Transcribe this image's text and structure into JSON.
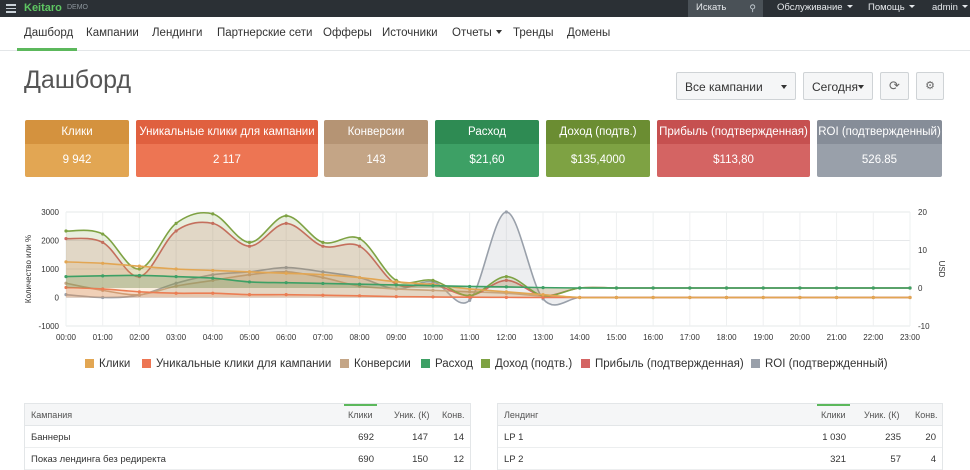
{
  "topbar": {
    "logo": "Keitaro",
    "demo": "DEMO",
    "search_label": "Искать",
    "service": "Обслуживание",
    "help": "Помощь",
    "user": "admin"
  },
  "nav": {
    "items": [
      "Дашборд",
      "Кампании",
      "Лендинги",
      "Партнерские сети",
      "Офферы",
      "Источники",
      "Отчеты",
      "Тренды",
      "Домены"
    ]
  },
  "title": "Дашборд",
  "controls": {
    "campaign_select": "Все кампании",
    "period_select": "Сегодня"
  },
  "stats": [
    {
      "label": "Клики",
      "value": "9 942",
      "head_color": "#d4923e",
      "body_color": "#e2a653"
    },
    {
      "label": "Уникальные клики для кампании",
      "value": "2 117",
      "head_color": "#e0603f",
      "body_color": "#ed7553"
    },
    {
      "label": "Конверсии",
      "value": "143",
      "head_color": "#b59474",
      "body_color": "#c4a586"
    },
    {
      "label": "Расход",
      "value": "$21,60",
      "head_color": "#2e8b53",
      "body_color": "#3da065"
    },
    {
      "label": "Доход (подтв.)",
      "value": "$135,4000",
      "head_color": "#6b8d32",
      "body_color": "#7ea243"
    },
    {
      "label": "Прибыль (подтвержденная)",
      "value": "$113,80",
      "head_color": "#c65050",
      "body_color": "#d46463"
    },
    {
      "label": "ROI (подтвержденный)",
      "value": "526.85",
      "head_color": "#868d98",
      "body_color": "#99a0aa"
    }
  ],
  "chart_data": {
    "type": "line",
    "ylabel_left": "Количество или %",
    "ylabel_right": "USD",
    "ylim_left": [
      -1000,
      3000
    ],
    "ylim_right": [
      -10,
      20
    ],
    "y_ticks_left": [
      "3000",
      "2000",
      "1000",
      "0",
      "-1000"
    ],
    "y_ticks_right": [
      "20",
      "10",
      "0",
      "-10"
    ],
    "categories": [
      "00:00",
      "01:00",
      "02:00",
      "03:00",
      "04:00",
      "05:00",
      "06:00",
      "07:00",
      "08:00",
      "09:00",
      "10:00",
      "11:00",
      "12:00",
      "13:00",
      "14:00",
      "15:00",
      "16:00",
      "17:00",
      "18:00",
      "19:00",
      "20:00",
      "21:00",
      "22:00",
      "23:00"
    ],
    "series": [
      {
        "name": "Клики",
        "color": "#e2a653",
        "axis": "left",
        "values": [
          1250,
          1200,
          1100,
          1000,
          950,
          900,
          850,
          800,
          700,
          550,
          450,
          300,
          200,
          100,
          0,
          0,
          0,
          0,
          0,
          0,
          0,
          0,
          0,
          0
        ]
      },
      {
        "name": "Уникальные клики для кампании",
        "color": "#ed7553",
        "axis": "left",
        "values": [
          350,
          300,
          200,
          150,
          150,
          100,
          100,
          80,
          60,
          30,
          20,
          10,
          5,
          0,
          0,
          0,
          0,
          0,
          0,
          0,
          0,
          0,
          0,
          0
        ]
      },
      {
        "name": "Конверсии",
        "color": "#c4a586",
        "axis": "left",
        "values": [
          500,
          250,
          100,
          400,
          600,
          800,
          900,
          700,
          400,
          300,
          250,
          200,
          150,
          50,
          0,
          0,
          0,
          0,
          0,
          0,
          0,
          0,
          0,
          0
        ]
      },
      {
        "name": "Расход",
        "color": "#3da065",
        "axis": "right",
        "values": [
          3,
          3.2,
          3.3,
          3.0,
          2.6,
          1.6,
          1.4,
          1.2,
          1.0,
          0.8,
          0.6,
          0.4,
          0.3,
          0.1,
          0,
          0,
          0,
          0,
          0,
          0,
          0,
          0,
          0,
          0
        ]
      },
      {
        "name": "Доход (подтв.)",
        "color": "#7ea243",
        "axis": "right",
        "values": [
          15,
          14.2,
          5,
          17,
          19.5,
          12,
          19,
          12,
          13,
          2,
          2,
          -2,
          3,
          -2,
          0,
          0,
          0,
          0,
          0,
          0,
          0,
          0,
          0,
          0
        ]
      },
      {
        "name": "Прибыль (подтвержденная)",
        "color": "#d46463",
        "axis": "right",
        "values": [
          13,
          12,
          3,
          15,
          17,
          11,
          17,
          11,
          11,
          1,
          1,
          -2,
          2,
          -2,
          0,
          0,
          0,
          0,
          0,
          0,
          0,
          0,
          0,
          0
        ]
      },
      {
        "name": "ROI (подтвержденный)",
        "color": "#99a0aa",
        "axis": "left",
        "values": [
          100,
          0,
          80,
          500,
          800,
          900,
          1050,
          900,
          700,
          300,
          550,
          -100,
          3000,
          -50,
          0,
          0,
          0,
          0,
          0,
          0,
          0,
          0,
          0,
          0
        ]
      }
    ]
  },
  "campaigns_table": {
    "headers": [
      "Кампания",
      "Клики",
      "Уник. (К)",
      "Конв."
    ],
    "rows": [
      [
        "Баннеры",
        "692",
        "147",
        "14"
      ],
      [
        "Показ лендинга без редиректа",
        "690",
        "150",
        "12"
      ]
    ]
  },
  "landings_table": {
    "headers": [
      "Лендинг",
      "Клики",
      "Уник. (К)",
      "Конв."
    ],
    "rows": [
      [
        "LP 1",
        "1 030",
        "235",
        "20"
      ],
      [
        "LP 2",
        "321",
        "57",
        "4"
      ]
    ]
  }
}
